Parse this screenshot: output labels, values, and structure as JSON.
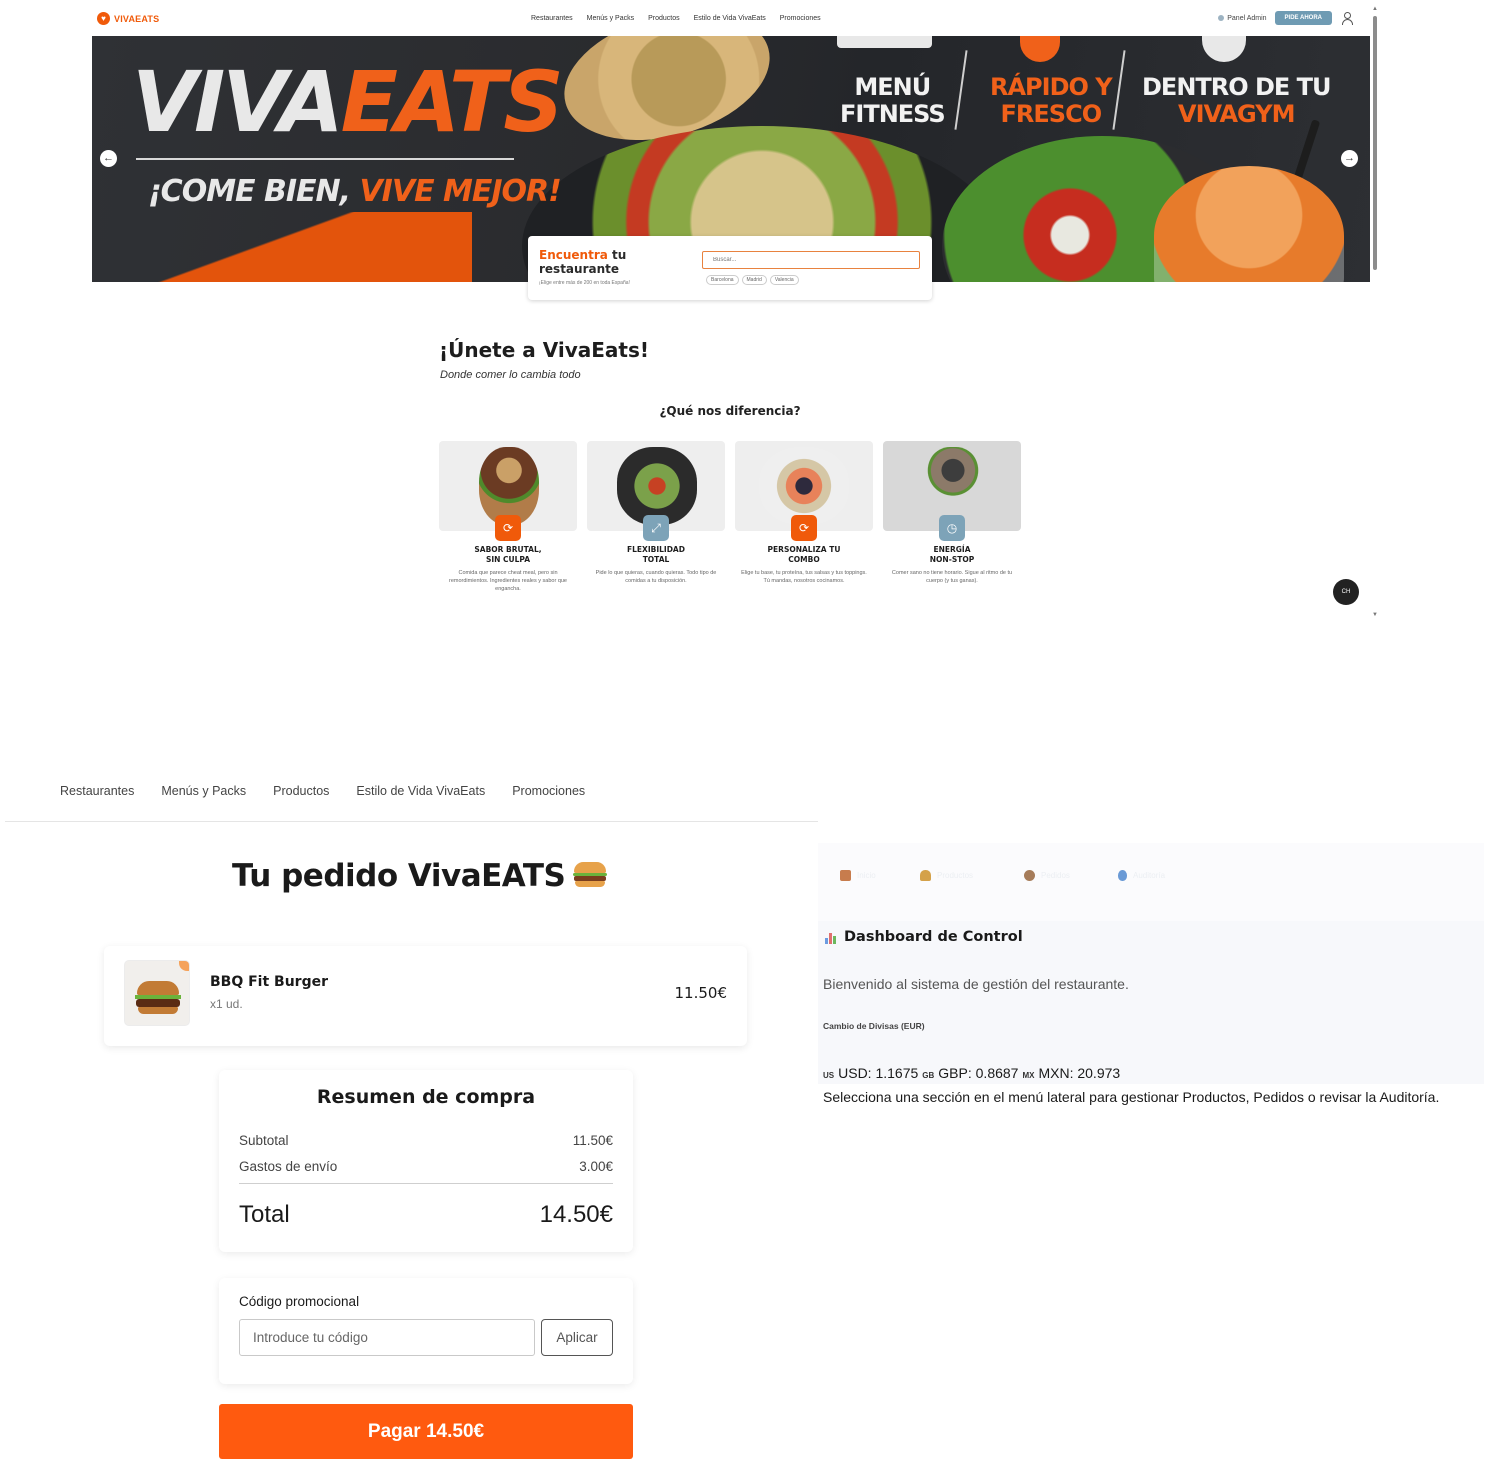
{
  "landing": {
    "brand": "VIVAEATS",
    "nav": [
      "Restaurantes",
      "Menús y Packs",
      "Productos",
      "Estilo de Vida VivaEats",
      "Promociones"
    ],
    "panel_admin": "Panel Admin",
    "cta": "PIDE AHORA",
    "hero": {
      "brand_white": "VIVA",
      "brand_orange": "EATS",
      "slogan_white": "¡COME BIEN, ",
      "slogan_orange": "VIVE MEJOR!",
      "tag1_l1": "MENÚ",
      "tag1_l2": "FITNESS",
      "tag2_l1": "RÁPIDO Y",
      "tag2_l2": "FRESCO",
      "tag3_l1": "DENTRO DE TU",
      "tag3_l2": "VIVAGYM"
    },
    "finder": {
      "title_orange": "Encuentra",
      "title_rest": " tu",
      "title_line2": "restaurante",
      "subtitle": "¡Elige entre más de 200 en toda España!",
      "search_placeholder": "Buscar...",
      "cities": [
        "Barcelona",
        "Madrid",
        "Valencia"
      ]
    },
    "join_title": "¡Únete a VivaEats!",
    "join_subtitle": "Donde comer lo cambia todo",
    "diff_title": "¿Qué nos diferencia?",
    "features": [
      {
        "title_l1": "SABOR BRUTAL,",
        "title_l2": "SIN CULPA",
        "desc": "Comida que parece cheat meal, pero sin remordimientos. Ingredientes reales y sabor que engancha."
      },
      {
        "title_l1": "FLEXIBILIDAD",
        "title_l2": "TOTAL",
        "desc": "Pide lo que quieras, cuando quieras. Todo tipo de comidas a tu disposición."
      },
      {
        "title_l1": "PERSONALIZA TU",
        "title_l2": "COMBO",
        "desc": "Elige tu base, tu proteína, tus salsas y tus toppings. Tú mandas, nosotros cocinamos."
      },
      {
        "title_l1": "ENERGÍA",
        "title_l2": "NON-STOP",
        "desc": "Comer sano no tiene horario. Sigue al ritmo de tu cuerpo (y tus ganas)."
      }
    ],
    "chat_label": "CH"
  },
  "cart": {
    "nav": [
      "Restaurantes",
      "Menús y Packs",
      "Productos",
      "Estilo de Vida VivaEats",
      "Promociones"
    ],
    "title": "Tu pedido VivaEATS",
    "item": {
      "name": "BBQ Fit Burger",
      "qty": "x1 ud.",
      "price": "11.50€"
    },
    "summary": {
      "title": "Resumen de compra",
      "subtotal_label": "Subtotal",
      "subtotal_value": "11.50€",
      "shipping_label": "Gastos de envío",
      "shipping_value": "3.00€",
      "total_label": "Total",
      "total_value": "14.50€"
    },
    "promo": {
      "label": "Código promocional",
      "placeholder": "Introduce tu código",
      "apply": "Aplicar"
    },
    "pay": "Pagar 14.50€"
  },
  "admin": {
    "tabs": [
      "Inicio",
      "Productos",
      "Pedidos",
      "Auditoría"
    ],
    "title": "Dashboard de Control",
    "welcome": "Bienvenido al sistema de gestión del restaurante.",
    "fx_label": "Cambio de Divisas (EUR)",
    "fx": [
      {
        "flag": "US",
        "text": "USD: 1.1675"
      },
      {
        "flag": "GB",
        "text": "GBP: 0.8687"
      },
      {
        "flag": "MX",
        "text": "MXN: 20.973"
      }
    ],
    "hint": "Selecciona una sección en el menú lateral para gestionar Productos, Pedidos o revisar la Auditoría."
  },
  "colors": {
    "brand_orange": "#f05a0a",
    "pay_orange": "#ff5a0f",
    "steel_blue": "#6f9bb3"
  }
}
